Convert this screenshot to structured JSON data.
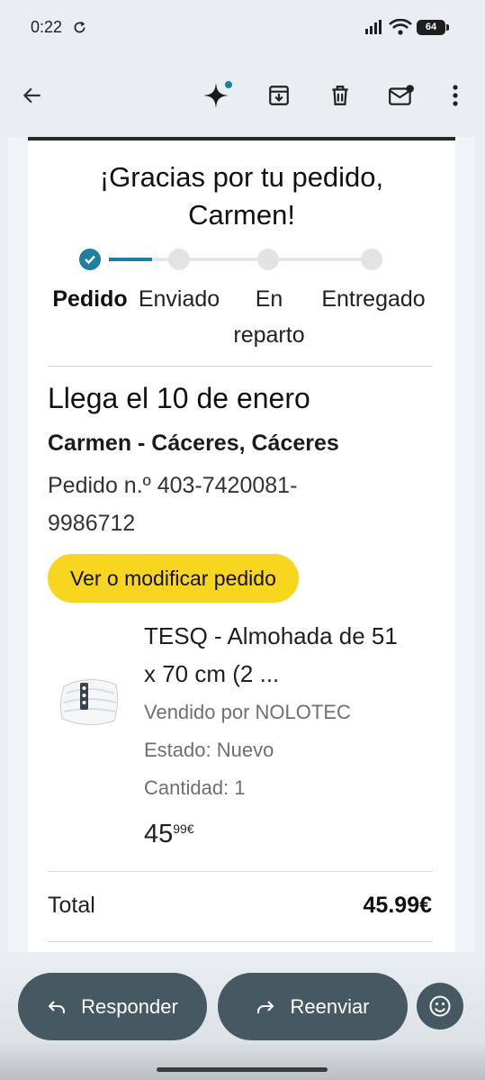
{
  "status_bar": {
    "time": "0:22",
    "battery": "64"
  },
  "app_bar": {
    "back_icon": "arrow-left-icon",
    "actions": [
      "sparkle-icon",
      "archive-icon",
      "trash-icon",
      "mark-unread-icon",
      "more-vert-icon"
    ]
  },
  "email": {
    "heading_line1": "¡Gracias por tu pedido,",
    "heading_line2": "Carmen!",
    "progress": {
      "current_step": 1,
      "accent_color": "#1e7fa0",
      "steps": [
        "Pedido",
        "Enviado",
        "En reparto",
        "Entregado"
      ],
      "step3_line1": "En",
      "step3_line2": "reparto"
    },
    "arrival": "Llega el 10 de enero",
    "address": "Carmen - Cáceres, Cáceres",
    "order_line1": "Pedido n.º 403-7420081-",
    "order_line2": "9986712",
    "modify_button": "Ver o modificar pedido",
    "product": {
      "title_line1": "TESQ - Almohada de 51",
      "title_line2": "x 70 cm (2 ...",
      "seller": "Vendido por NOLOTEC",
      "condition": "Estado: Nuevo",
      "quantity": "Cantidad: 1",
      "price_int": "45",
      "price_cents": "99€"
    },
    "total_label": "Total",
    "total_value": "45.99€"
  },
  "bottom_actions": {
    "reply": "Responder",
    "forward": "Reenviar",
    "emoji_icon": "smiley-icon"
  }
}
